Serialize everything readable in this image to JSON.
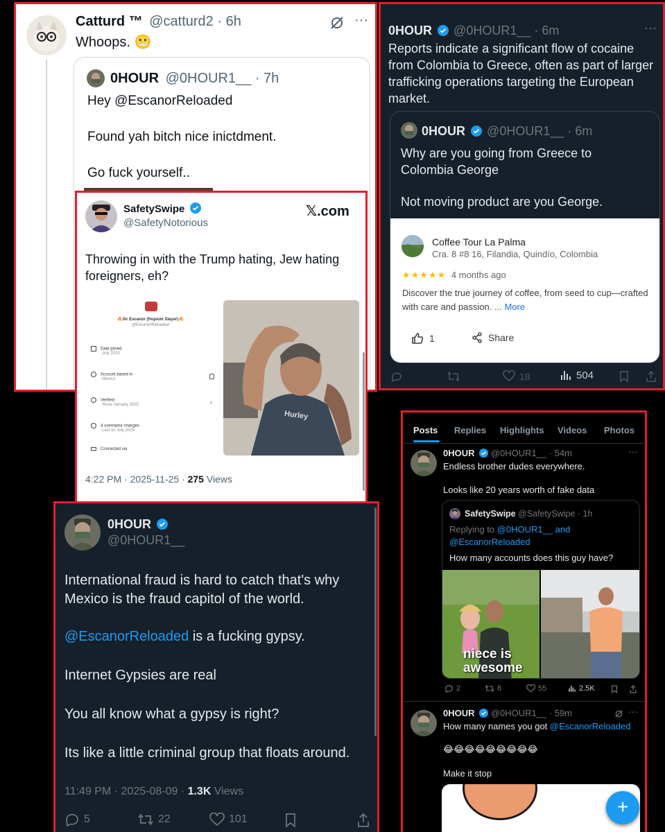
{
  "panel1": {
    "author_name": "Catturd ™",
    "author_handle": "@catturd2 · 6h",
    "text": "Whoops. 😬",
    "quote": {
      "author_name": "0HOUR",
      "author_handle": "@0HOUR1__ · 7h",
      "line1": "Hey @EscanorReloaded",
      "line2": "Found yah bitch nice inictdment.",
      "line3": "Go fuck yourself.."
    }
  },
  "panel2": {
    "author_name": "SafetySwipe",
    "author_handle": "@SafetyNotorious",
    "brand": "𝕏.com",
    "text": "Throwing in with the Trump hating, Jew hating foreigners, eh?",
    "inner_profile": {
      "name": "🔥Sir Escanor (Hopium Slayer)🔥",
      "handle": "@EscanorReloaded",
      "rows": [
        {
          "label": "Date joined",
          "value": "July 2023"
        },
        {
          "label": "Account based in",
          "value": "Mexico"
        },
        {
          "label": "Verified",
          "value": "Since January 2025"
        },
        {
          "label": "4 username changes",
          "value": "Last on July 2025"
        },
        {
          "label": "Connected via",
          "value": ""
        }
      ],
      "watermark": "Hurley"
    },
    "meta_time": "4:22 PM · 2025-11-25 · ",
    "meta_views_count": "275",
    "meta_views_label": " Views"
  },
  "panel3": {
    "author_name": "0HOUR",
    "author_handle": "@0HOUR1__ · 6m",
    "text": "Reports indicate a significant flow of cocaine from Colombia to Greece, often as part of larger trafficking operations targeting the European market.",
    "quote": {
      "author_name": "0HOUR",
      "author_handle": "@0HOUR1__ · 6m",
      "line1": "Why are you going from Greece to Colombia George",
      "line2": "Not moving product are you George."
    },
    "place": {
      "name": "Coffee Tour La Palma",
      "address": "Cra. 8 #8 16, Filandia, Quindío, Colombia",
      "stars": "★★★★★",
      "age": "4 months ago",
      "desc": "Discover the true journey of coffee, from seed to cup—crafted with care and passion. ...",
      "more": "More",
      "like_count": "1",
      "share": "Share"
    },
    "actions": {
      "likes": "18",
      "views": "504"
    }
  },
  "panel4": {
    "author_name": "0HOUR",
    "author_handle": "@0HOUR1__",
    "p1": "International fraud is hard to catch that's why Mexico is the fraud capitol of the world.",
    "mention": "@EscanorReloaded",
    "p2_rest": " is a fucking gypsy.",
    "p3": "Internet Gypsies are real",
    "p4": "You all know what a gypsy is right?",
    "p5": "Its like a little criminal group that floats around.",
    "meta_time": "11:49 PM · 2025-08-09 · ",
    "meta_views_count": "1.3K",
    "meta_views_label": " Views",
    "actions": {
      "replies": "5",
      "reposts": "22",
      "likes": "101"
    }
  },
  "panel5": {
    "tabs": [
      "Posts",
      "Replies",
      "Highlights",
      "Videos",
      "Photos"
    ],
    "post1": {
      "author_name": "0HOUR",
      "author_handle": "@0HOUR1__ · 54m",
      "line1": "Endless brother dudes everywhere.",
      "line2": "Looks like 20 years worth of fake data",
      "quote": {
        "author_name": "SafetySwipe",
        "author_handle": "@SafetySwipe · 1h",
        "replying_prefix": "Replying to ",
        "replying_to": "@0HOUR1__ and @EscanorReloaded",
        "text": "How many accounts does this guy have?",
        "caption": "niece is awesome"
      },
      "actions": {
        "replies": "2",
        "reposts": "8",
        "likes": "55",
        "views": "2.5K"
      }
    },
    "post2": {
      "author_name": "0HOUR",
      "author_handle": "@0HOUR1__ · 59m",
      "text_prefix": "How many names you got ",
      "mention": "@EscanorReloaded",
      "emojis": "😂😂😂😂😂😂😂😂😂",
      "line3": "Make it stop"
    },
    "fab": "+"
  },
  "colors": {
    "frame": "#e0202d",
    "accent": "#1d9bf0",
    "dark_bg": "#15202b",
    "light_bg": "#ffffff"
  }
}
